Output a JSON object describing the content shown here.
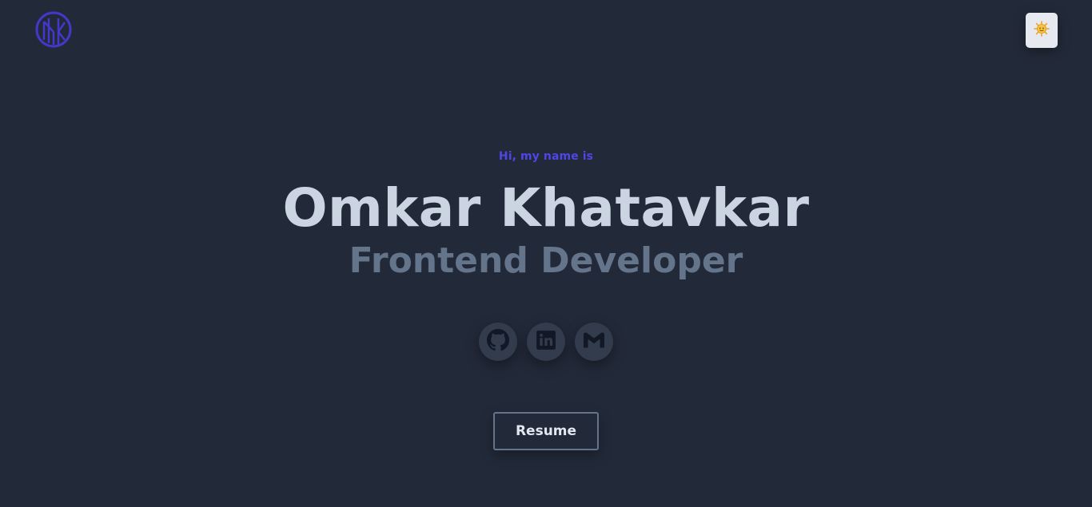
{
  "header": {
    "logo_icon": "mk-monogram-icon",
    "theme_toggle_icon": "sun-face-icon"
  },
  "hero": {
    "greeting": "Hi, my name is",
    "name": "Omkar Khatavkar",
    "role": "Frontend Developer"
  },
  "socials": [
    {
      "icon": "github-icon"
    },
    {
      "icon": "linkedin-icon"
    },
    {
      "icon": "gmail-icon"
    }
  ],
  "resume_button": {
    "label": "Resume"
  },
  "colors": {
    "background": "#222938",
    "accent": "#4f46e5",
    "name_text": "#cbd5e1",
    "role_text": "#64748b",
    "social_bg": "#333c4c",
    "social_icon": "#131826"
  }
}
